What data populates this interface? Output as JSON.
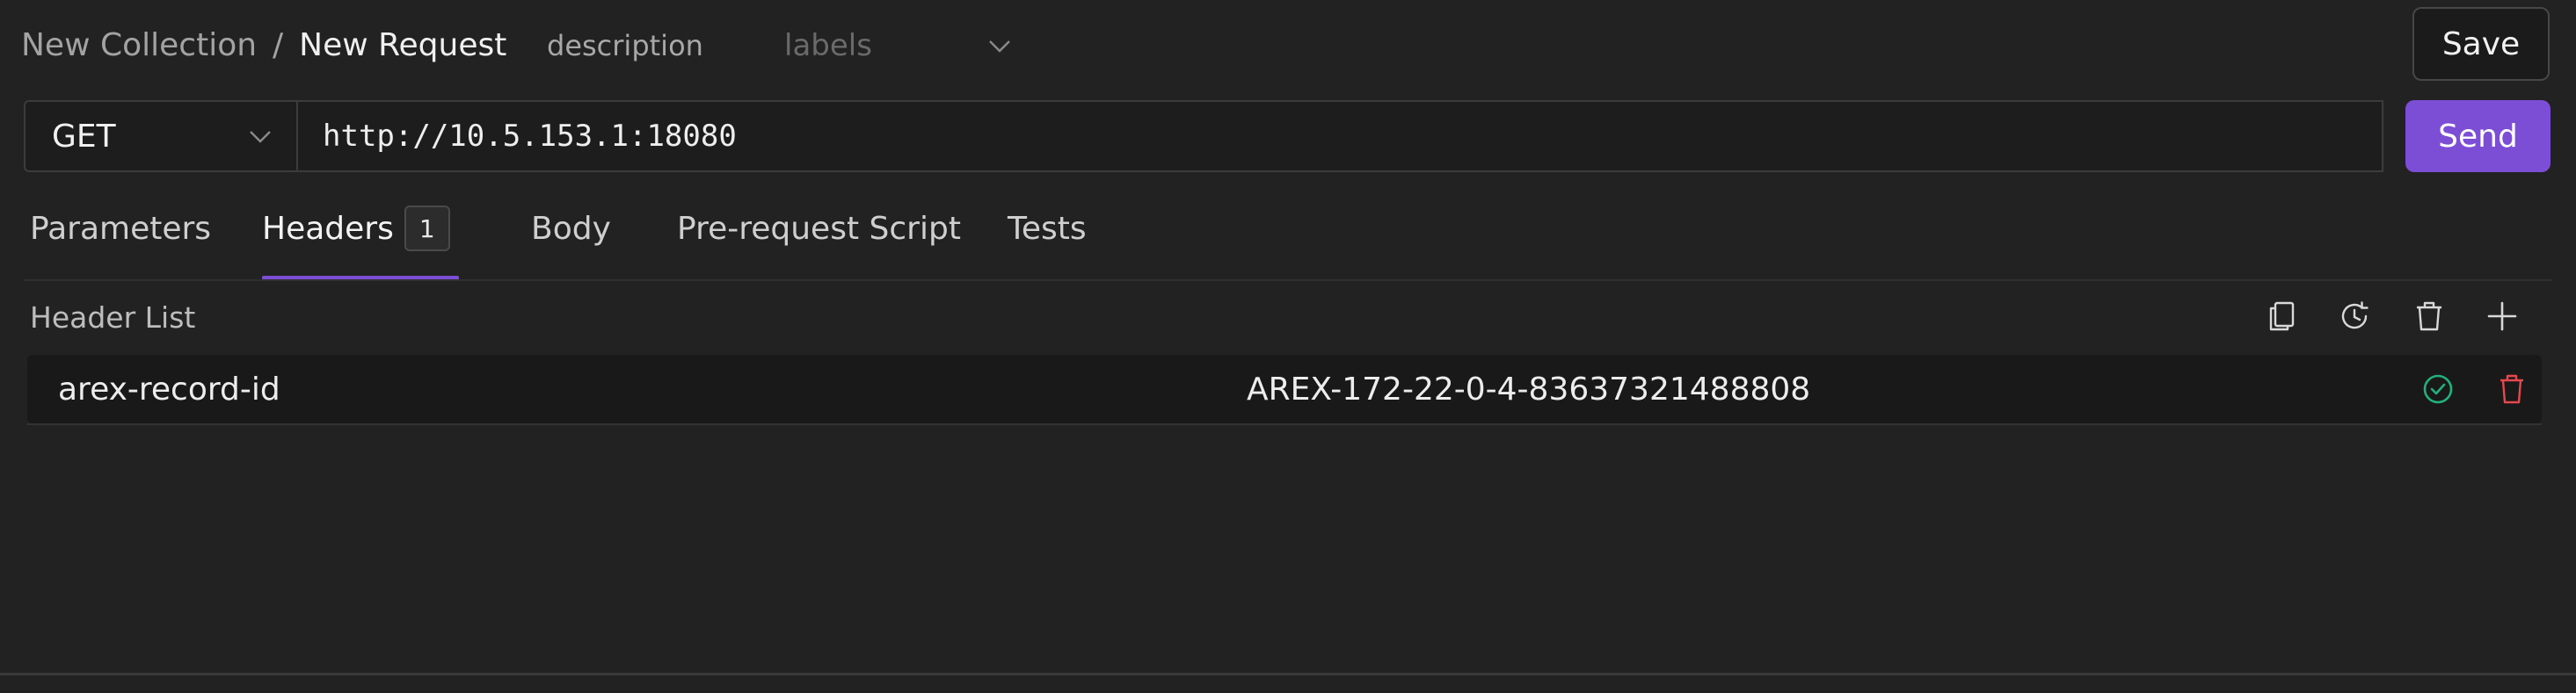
{
  "breadcrumb": {
    "collection": "New Collection",
    "separator": "/",
    "request": "New Request"
  },
  "meta": {
    "description_label": "description",
    "labels_placeholder": "labels"
  },
  "toolbar": {
    "save_label": "Save",
    "send_label": "Send"
  },
  "request": {
    "method": "GET",
    "url": "http://10.5.153.1:18080"
  },
  "tabs": [
    {
      "label": "Parameters"
    },
    {
      "label": "Headers",
      "badge": "1",
      "active": true
    },
    {
      "label": "Body"
    },
    {
      "label": "Pre-request Script"
    },
    {
      "label": "Tests"
    }
  ],
  "header_list": {
    "title": "Header List",
    "actions": [
      "copy-icon",
      "history-icon",
      "delete-icon",
      "plus-icon"
    ],
    "rows": [
      {
        "key": "arex-record-id",
        "value": "AREX-172-22-0-4-83637321488808",
        "enabled": true
      }
    ]
  },
  "colors": {
    "accent": "#7c4ed6",
    "enabled": "#22b07d",
    "delete": "#e5484d",
    "background": "#222222"
  }
}
